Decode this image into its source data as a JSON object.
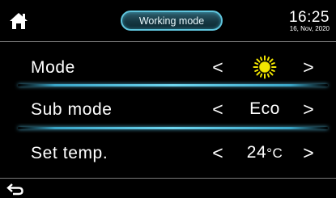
{
  "header": {
    "home_icon": "home-icon",
    "mode_title": "Working mode",
    "time": "16:25",
    "date": "16, Nov, 2020"
  },
  "settings": [
    {
      "label": "Mode",
      "prev": "<",
      "next": ">",
      "value": "",
      "value_icon": "sun-icon"
    },
    {
      "label": "Sub mode",
      "prev": "<",
      "next": ">",
      "value": "Eco"
    },
    {
      "label": "Set temp.",
      "prev": "<",
      "next": ">",
      "value": "24",
      "unit": "°C"
    }
  ],
  "footer": {
    "back_icon": "back-arrow-icon"
  },
  "colors": {
    "background": "#000000",
    "accent": "#5fc4dc",
    "sun": "#f2e600",
    "text": "#ffffff"
  }
}
